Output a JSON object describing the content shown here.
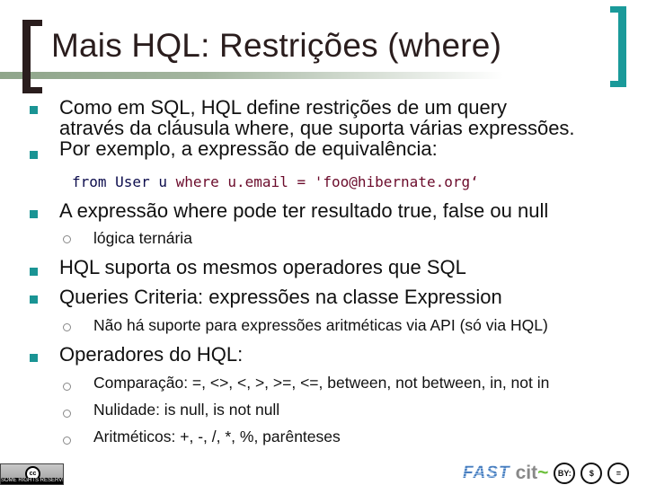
{
  "slide": {
    "title": "Mais HQL: Restrições (where)",
    "colors": {
      "title": "#2a1d1d",
      "accent_teal": "#1a9494",
      "code_keyword_blue": "#0d0d4d",
      "code_keyword_red": "#6b0b2b"
    },
    "bullets": [
      {
        "level": 1,
        "lines": [
          "Como em SQL, HQL define restrições de um query",
          "através da cláusula where, que suporta várias expressões."
        ]
      },
      {
        "level": 1,
        "lines": [
          "Por exemplo, a expressão de equivalência:"
        ]
      },
      {
        "level": 1,
        "lines": [
          "A expressão where pode ter resultado true, false ou null"
        ]
      },
      {
        "level": 2,
        "lines": [
          "lógica ternária"
        ]
      },
      {
        "level": 1,
        "lines": [
          "HQL suporta os mesmos operadores que SQL"
        ]
      },
      {
        "level": 1,
        "lines": [
          "Queries Criteria: expressões na classe Expression"
        ]
      },
      {
        "level": 2,
        "lines": [
          "Não há suporte para expressões aritméticas via API (só via HQL)"
        ]
      },
      {
        "level": 1,
        "lines": [
          "Operadores do HQL:"
        ]
      },
      {
        "level": 2,
        "lines": [
          "Comparação: =, <>, <, >, >=, <=, between, not between, in, not in"
        ]
      },
      {
        "level": 2,
        "lines": [
          "Nulidade: is null, is not null"
        ]
      },
      {
        "level": 2,
        "lines": [
          "Aritméticos: +, -, /, *, %, parênteses"
        ]
      }
    ],
    "code": {
      "part1": "from User u ",
      "part2": "where u.email = 'foo@hibernate.org‘"
    }
  },
  "footer": {
    "cc_badge_symbol": "cc",
    "cc_badge_text": "SOME RIGHTS RESERVED",
    "logo_fast": "FAST",
    "logo_cit": "cit",
    "license_icons": [
      "BY:",
      "$",
      "="
    ]
  }
}
